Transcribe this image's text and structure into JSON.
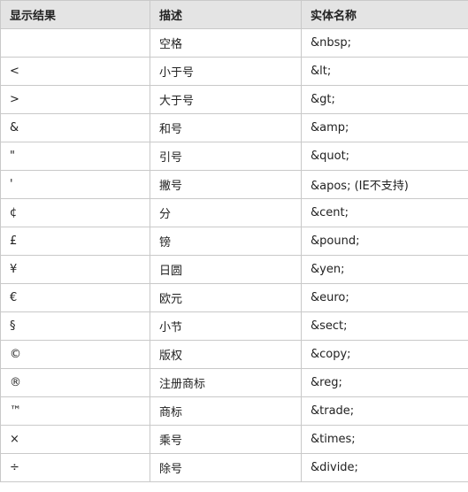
{
  "table": {
    "headers": [
      "显示结果",
      "描述",
      "实体名称"
    ],
    "rows": [
      [
        "",
        "空格",
        "&nbsp;"
      ],
      [
        "<",
        "小于号",
        "&lt;"
      ],
      [
        ">",
        "大于号",
        "&gt;"
      ],
      [
        "&",
        "和号",
        "&amp;"
      ],
      [
        "\"",
        "引号",
        "&quot;"
      ],
      [
        "'",
        "撇号",
        "&apos; (IE不支持)"
      ],
      [
        "¢",
        "分",
        "&cent;"
      ],
      [
        "£",
        "镑",
        "&pound;"
      ],
      [
        "¥",
        "日圆",
        "&yen;"
      ],
      [
        "€",
        "欧元",
        "&euro;"
      ],
      [
        "§",
        "小节",
        "&sect;"
      ],
      [
        "©",
        "版权",
        "&copy;"
      ],
      [
        "®",
        "注册商标",
        "&reg;"
      ],
      [
        "™",
        "商标",
        "&trade;"
      ],
      [
        "×",
        "乘号",
        "&times;"
      ],
      [
        "÷",
        "除号",
        "&divide;"
      ]
    ]
  }
}
